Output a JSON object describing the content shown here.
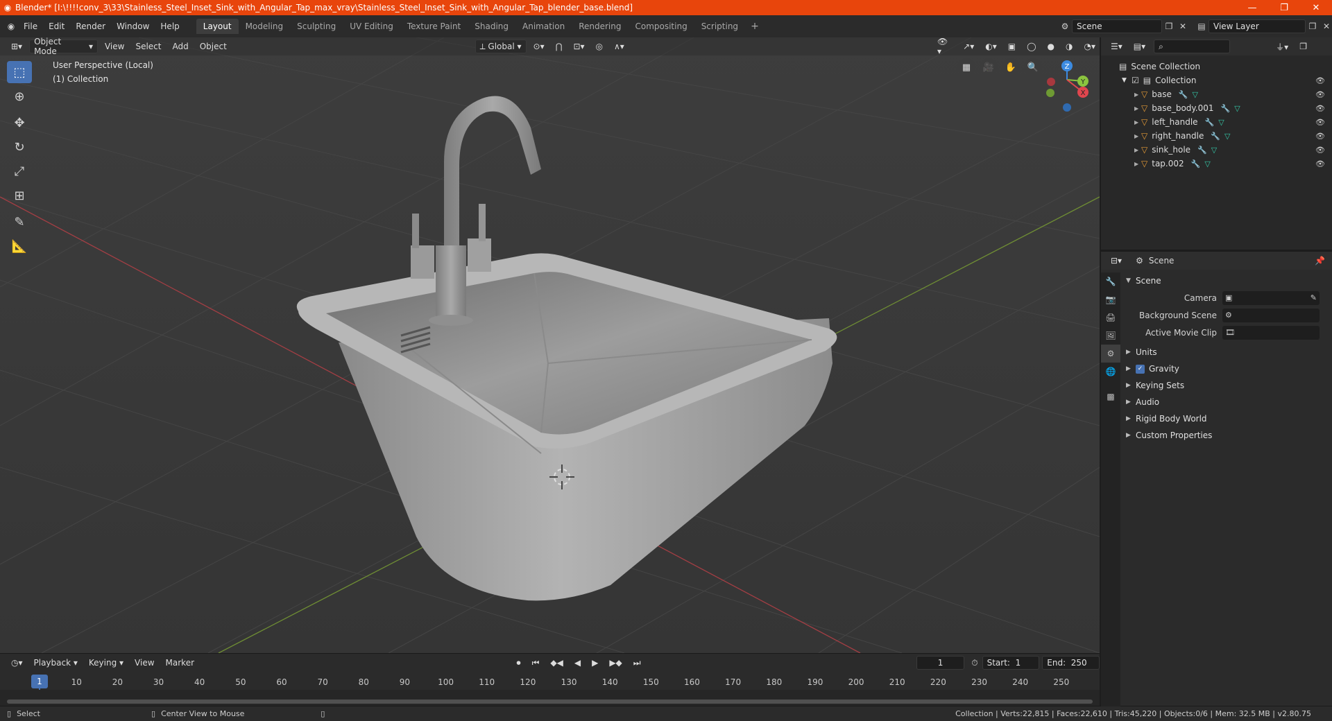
{
  "window": {
    "title": "Blender* [I:\\!!!!conv_3\\33\\Stainless_Steel_Inset_Sink_with_Angular_Tap_max_vray\\Stainless_Steel_Inset_Sink_with_Angular_Tap_blender_base.blend]",
    "minimize": "—",
    "maximize": "❐",
    "close": "✕"
  },
  "menu": {
    "items": [
      "File",
      "Edit",
      "Render",
      "Window",
      "Help"
    ],
    "workspaces": [
      "Layout",
      "Modeling",
      "Sculpting",
      "UV Editing",
      "Texture Paint",
      "Shading",
      "Animation",
      "Rendering",
      "Compositing",
      "Scripting"
    ],
    "active_workspace": "Layout",
    "add": "+",
    "scene_name": "Scene",
    "view_layer": "View Layer"
  },
  "viewport": {
    "mode": "Object Mode",
    "menus": [
      "View",
      "Select",
      "Add",
      "Object"
    ],
    "transform_orientation": "Global",
    "perspective_label": "User Perspective (Local)",
    "collection_label": "(1) Collection",
    "gizmo": {
      "x": "X",
      "y": "Y",
      "z": "Z"
    }
  },
  "timeline": {
    "menus": [
      "Playback",
      "Keying",
      "View",
      "Marker"
    ],
    "current_frame": "1",
    "start_label": "Start:",
    "start_value": "1",
    "end_label": "End:",
    "end_value": "250",
    "ticks": [
      "1",
      "10",
      "20",
      "30",
      "40",
      "50",
      "60",
      "70",
      "80",
      "90",
      "100",
      "110",
      "120",
      "130",
      "140",
      "150",
      "160",
      "170",
      "180",
      "190",
      "200",
      "210",
      "220",
      "230",
      "240",
      "250"
    ]
  },
  "outliner": {
    "root": "Scene Collection",
    "collection": "Collection",
    "objects": [
      "base",
      "base_body.001",
      "left_handle",
      "right_handle",
      "sink_hole",
      "tap.002"
    ]
  },
  "properties": {
    "context": "Scene",
    "panel": "Scene",
    "camera_label": "Camera",
    "background_label": "Background Scene",
    "movie_clip_label": "Active Movie Clip",
    "sections": [
      "Units",
      "Gravity",
      "Keying Sets",
      "Audio",
      "Rigid Body World",
      "Custom Properties"
    ]
  },
  "status": {
    "select": "Select",
    "center_view": "Center View to Mouse",
    "stats": "Collection | Verts:22,815 | Faces:22,610 | Tris:45,220 | Objects:0/6 | Mem: 32.5 MB | v2.80.75"
  },
  "colors": {
    "title_bar": "#e8450c",
    "accent": "#4772b3",
    "x_axis": "#e0464e",
    "y_axis": "#8bc43f",
    "z_axis": "#3c8be0"
  }
}
